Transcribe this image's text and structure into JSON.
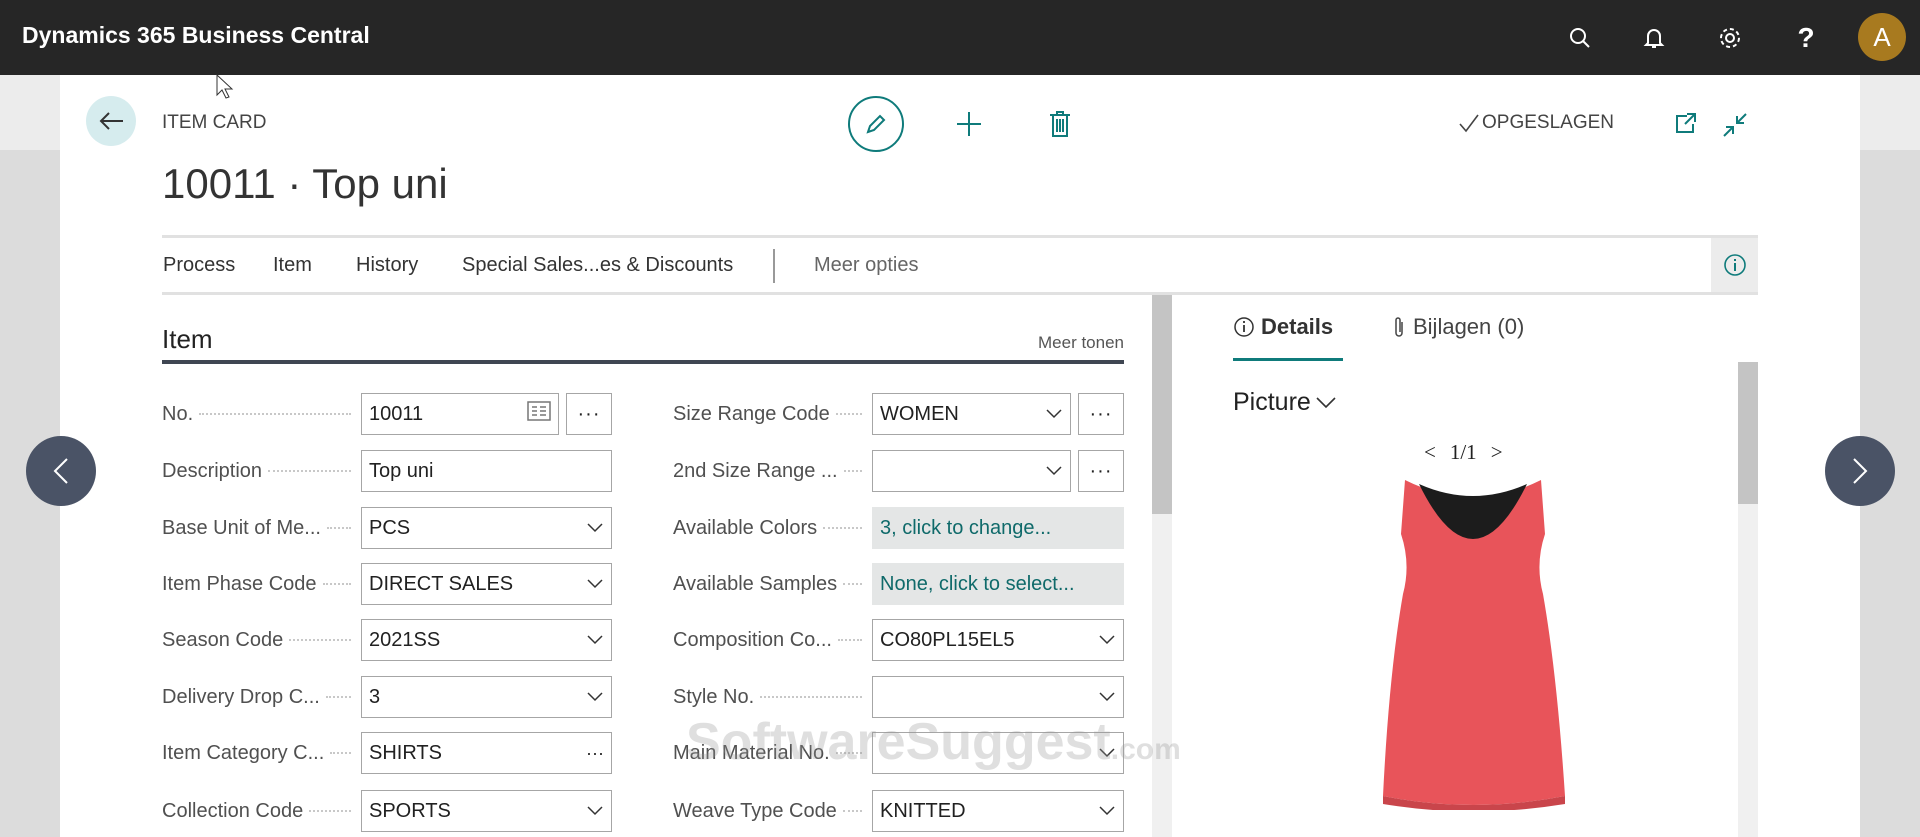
{
  "app": {
    "title": "Dynamics 365 Business Central",
    "avatar_initial": "A",
    "avatar_color": "#a87a1f"
  },
  "header_icons": [
    "search-icon",
    "bell-icon",
    "gear-icon",
    "help-icon"
  ],
  "help_glyph": "?",
  "page": {
    "type_label": "ITEM CARD",
    "title": "10011 · Top uni",
    "saved_status": "OPGESLAGEN"
  },
  "actions": {
    "items": [
      "Process",
      "Item",
      "History",
      "Special Sales...es & Discounts"
    ],
    "more": "Meer opties"
  },
  "section": {
    "title": "Item",
    "show_more": "Meer tonen"
  },
  "left_fields": [
    {
      "label": "No.",
      "value": "10011"
    },
    {
      "label": "Description",
      "value": "Top uni"
    },
    {
      "label": "Base Unit of Me...",
      "value": "PCS"
    },
    {
      "label": "Item Phase Code",
      "value": "DIRECT SALES"
    },
    {
      "label": "Season Code",
      "value": "2021SS"
    },
    {
      "label": "Delivery Drop C...",
      "value": "3"
    },
    {
      "label": "Item Category C...",
      "value": "SHIRTS"
    },
    {
      "label": "Collection Code",
      "value": "SPORTS"
    }
  ],
  "right_fields": [
    {
      "label": "Size Range Code",
      "value": "WOMEN"
    },
    {
      "label": "2nd Size Range ...",
      "value": ""
    },
    {
      "label": "Available Colors",
      "value": "3, click to change..."
    },
    {
      "label": "Available Samples",
      "value": "None, click to select..."
    },
    {
      "label": "Composition Co...",
      "value": "CO80PL15EL5"
    },
    {
      "label": "Style No.",
      "value": ""
    },
    {
      "label": "Main Material No.",
      "value": ""
    },
    {
      "label": "Weave Type Code",
      "value": "KNITTED"
    }
  ],
  "factbox": {
    "tabs": [
      "Details",
      "Bijlagen (0)"
    ],
    "picture_title": "Picture",
    "pager": {
      "prev": "<",
      "current": "1/1",
      "next": ">"
    }
  },
  "watermark": "SoftwareSuggest.com",
  "colors": {
    "accent": "#0f7b7b",
    "topbar": "#262626",
    "product": "#e8545a"
  }
}
